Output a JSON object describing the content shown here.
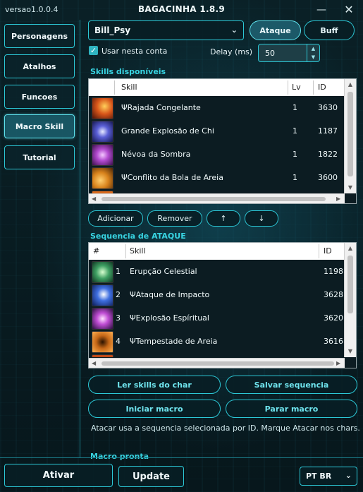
{
  "window": {
    "version": "versao1.0.0.4",
    "title": "BAGACINHA 1.8.9",
    "minimize_glyph": "—",
    "close_glyph": "✕"
  },
  "sidebar": {
    "items": [
      {
        "label": "Personagens",
        "active": false
      },
      {
        "label": "Atalhos",
        "active": false
      },
      {
        "label": "Funcoes",
        "active": false
      },
      {
        "label": "Macro Skill",
        "active": true
      },
      {
        "label": "Tutorial",
        "active": false
      }
    ]
  },
  "header": {
    "character_select": "Bill_Psy",
    "chevron_glyph": "⌄",
    "ataque_label": "Ataque",
    "buff_label": "Buff",
    "use_account_label": "Usar nesta conta",
    "use_account_checked": true,
    "delay_label": "Delay (ms)",
    "delay_value": "50"
  },
  "available": {
    "section_label": "Skills disponíveis",
    "columns": {
      "skill": "Skill",
      "lv": "Lv",
      "id": "ID"
    },
    "rows": [
      {
        "skill": "ΨRajada Congelante",
        "lv": "1",
        "id": "3630",
        "icon": "fire-burst-icon",
        "color": "#d8561a"
      },
      {
        "skill": "Grande Explosão de Chi",
        "lv": "1",
        "id": "1187",
        "icon": "chi-explosion-icon",
        "color": "#5a5fd6"
      },
      {
        "skill": "Névoa da Sombra",
        "lv": "1",
        "id": "1822",
        "icon": "shadow-mist-icon",
        "color": "#b34bd0"
      },
      {
        "skill": "ΨConflito da Bola de Areia",
        "lv": "1",
        "id": "3600",
        "icon": "sand-ball-icon",
        "color": "#d9831c"
      }
    ],
    "buttons": {
      "add": "Adicionar",
      "remove": "Remover",
      "up": "↑",
      "down": "↓"
    }
  },
  "sequence": {
    "section_label": "Sequencia de ATAQUE",
    "columns": {
      "num": "#",
      "skill": "Skill",
      "id": "ID"
    },
    "rows": [
      {
        "num": "1",
        "skill": "Erupção Celestial",
        "id": "1198",
        "icon": "celestial-eruption-icon",
        "color": "#3fa063"
      },
      {
        "num": "2",
        "skill": "ΨAtaque de Impacto",
        "id": "3628",
        "icon": "impact-attack-icon",
        "color": "#3f6fe0"
      },
      {
        "num": "3",
        "skill": "ΨExplosão Espíritual",
        "id": "3620",
        "icon": "spirit-explosion-icon",
        "color": "#c04dd4"
      },
      {
        "num": "4",
        "skill": "ΨTempestade de Areia",
        "id": "3616",
        "icon": "sandstorm-icon",
        "color": "#c66818"
      }
    ]
  },
  "actions": {
    "read_skills": "Ler skills do char",
    "save_sequence": "Salvar sequencia",
    "start_macro": "Iniciar macro",
    "stop_macro": "Parar macro",
    "hint": "Atacar usa a sequencia selecionada por ID. Marque Atacar nos chars.",
    "ready_label": "Macro pronta"
  },
  "footer": {
    "activate": "Ativar",
    "update": "Update",
    "language": "PT BR"
  }
}
